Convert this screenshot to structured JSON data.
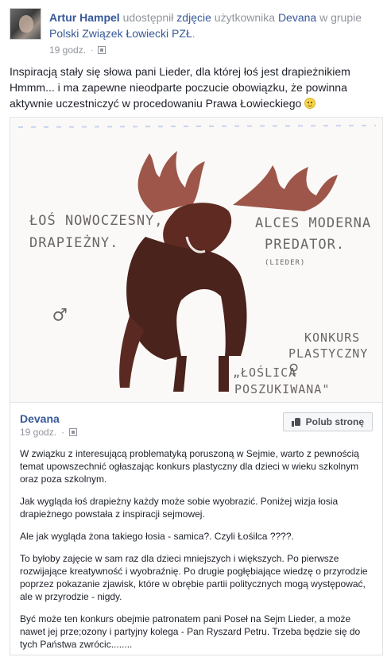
{
  "post": {
    "author": "Artur Hampel",
    "action_shared": "udostępnił",
    "photo_word": "zdjęcie",
    "of_user": "użytkownika",
    "source_user": "Devana",
    "in_group": "w grupie",
    "group_name": "Polski Związek Łowiecki PZŁ",
    "group_dot": ".",
    "time": "19 godz.",
    "audience_icon": "group-icon",
    "text": "Inspiracją stały się słowa pani Lieder, dla której łoś jest drapieżnikiem Hmmm... i ma zapewne nieodparte poczucie obowiązku, że powinna aktywnie uczestniczyć w procedowaniu Prawa Łowieckiego",
    "emoji": "smile-icon"
  },
  "image": {
    "left_caption_line1": "ŁOŚ NOWOCZESNY,",
    "left_caption_line2": "DRAPIEŻNY.",
    "right_caption_line1": "ALCES MODERNA",
    "right_caption_line2": "PREDATOR.",
    "right_caption_note": "(LIEDER)",
    "contest_line1": "KONKURS",
    "contest_line2": "PLASTYCZNY",
    "search_line1": "„ŁOŚLICA",
    "search_line2": "POSZUKIWANA\"",
    "male_symbol": "♂",
    "female_symbol": "♀"
  },
  "shared": {
    "page_name": "Devana",
    "time": "19 godz.",
    "audience_icon": "globe-icon",
    "like_label": "Polub stronę",
    "paragraphs": [
      "W związku z interesującą problematyką poruszoną w Sejmie, warto z pewnością temat upowszechnić ogłaszając konkurs plastyczny dla dzieci w wieku szkolnym oraz poza szkolnym.",
      "Jak wygląda łoś drapieżny każdy może sobie wyobrazić. Poniżej wizja łosia drapieżnego powstała z inspiracji sejmowej.",
      "Ale jak wygląda żona takiego łosia - samica?. Czyli Łośilca ????.",
      "To byłoby zajęcie w sam raz dla dzieci mniejszych i większych. Po pierwsze rozwijające kreatywność i wyobraźnię. Po drugie pogłębiające wiedzę o przyrodzie poprzez pokazanie zjawisk, które w obrębie partii politycznych mogą występować, ale w przyrodzie - nigdy.",
      "Być może ten konkurs obejmie patronatem pani Poseł na Sejm Lieder, a może nawet jej prze;ozony i partyjny kolega - Pan Ryszard Petru. Trzeba będzie się do tych Państwa zwrócic........"
    ]
  }
}
